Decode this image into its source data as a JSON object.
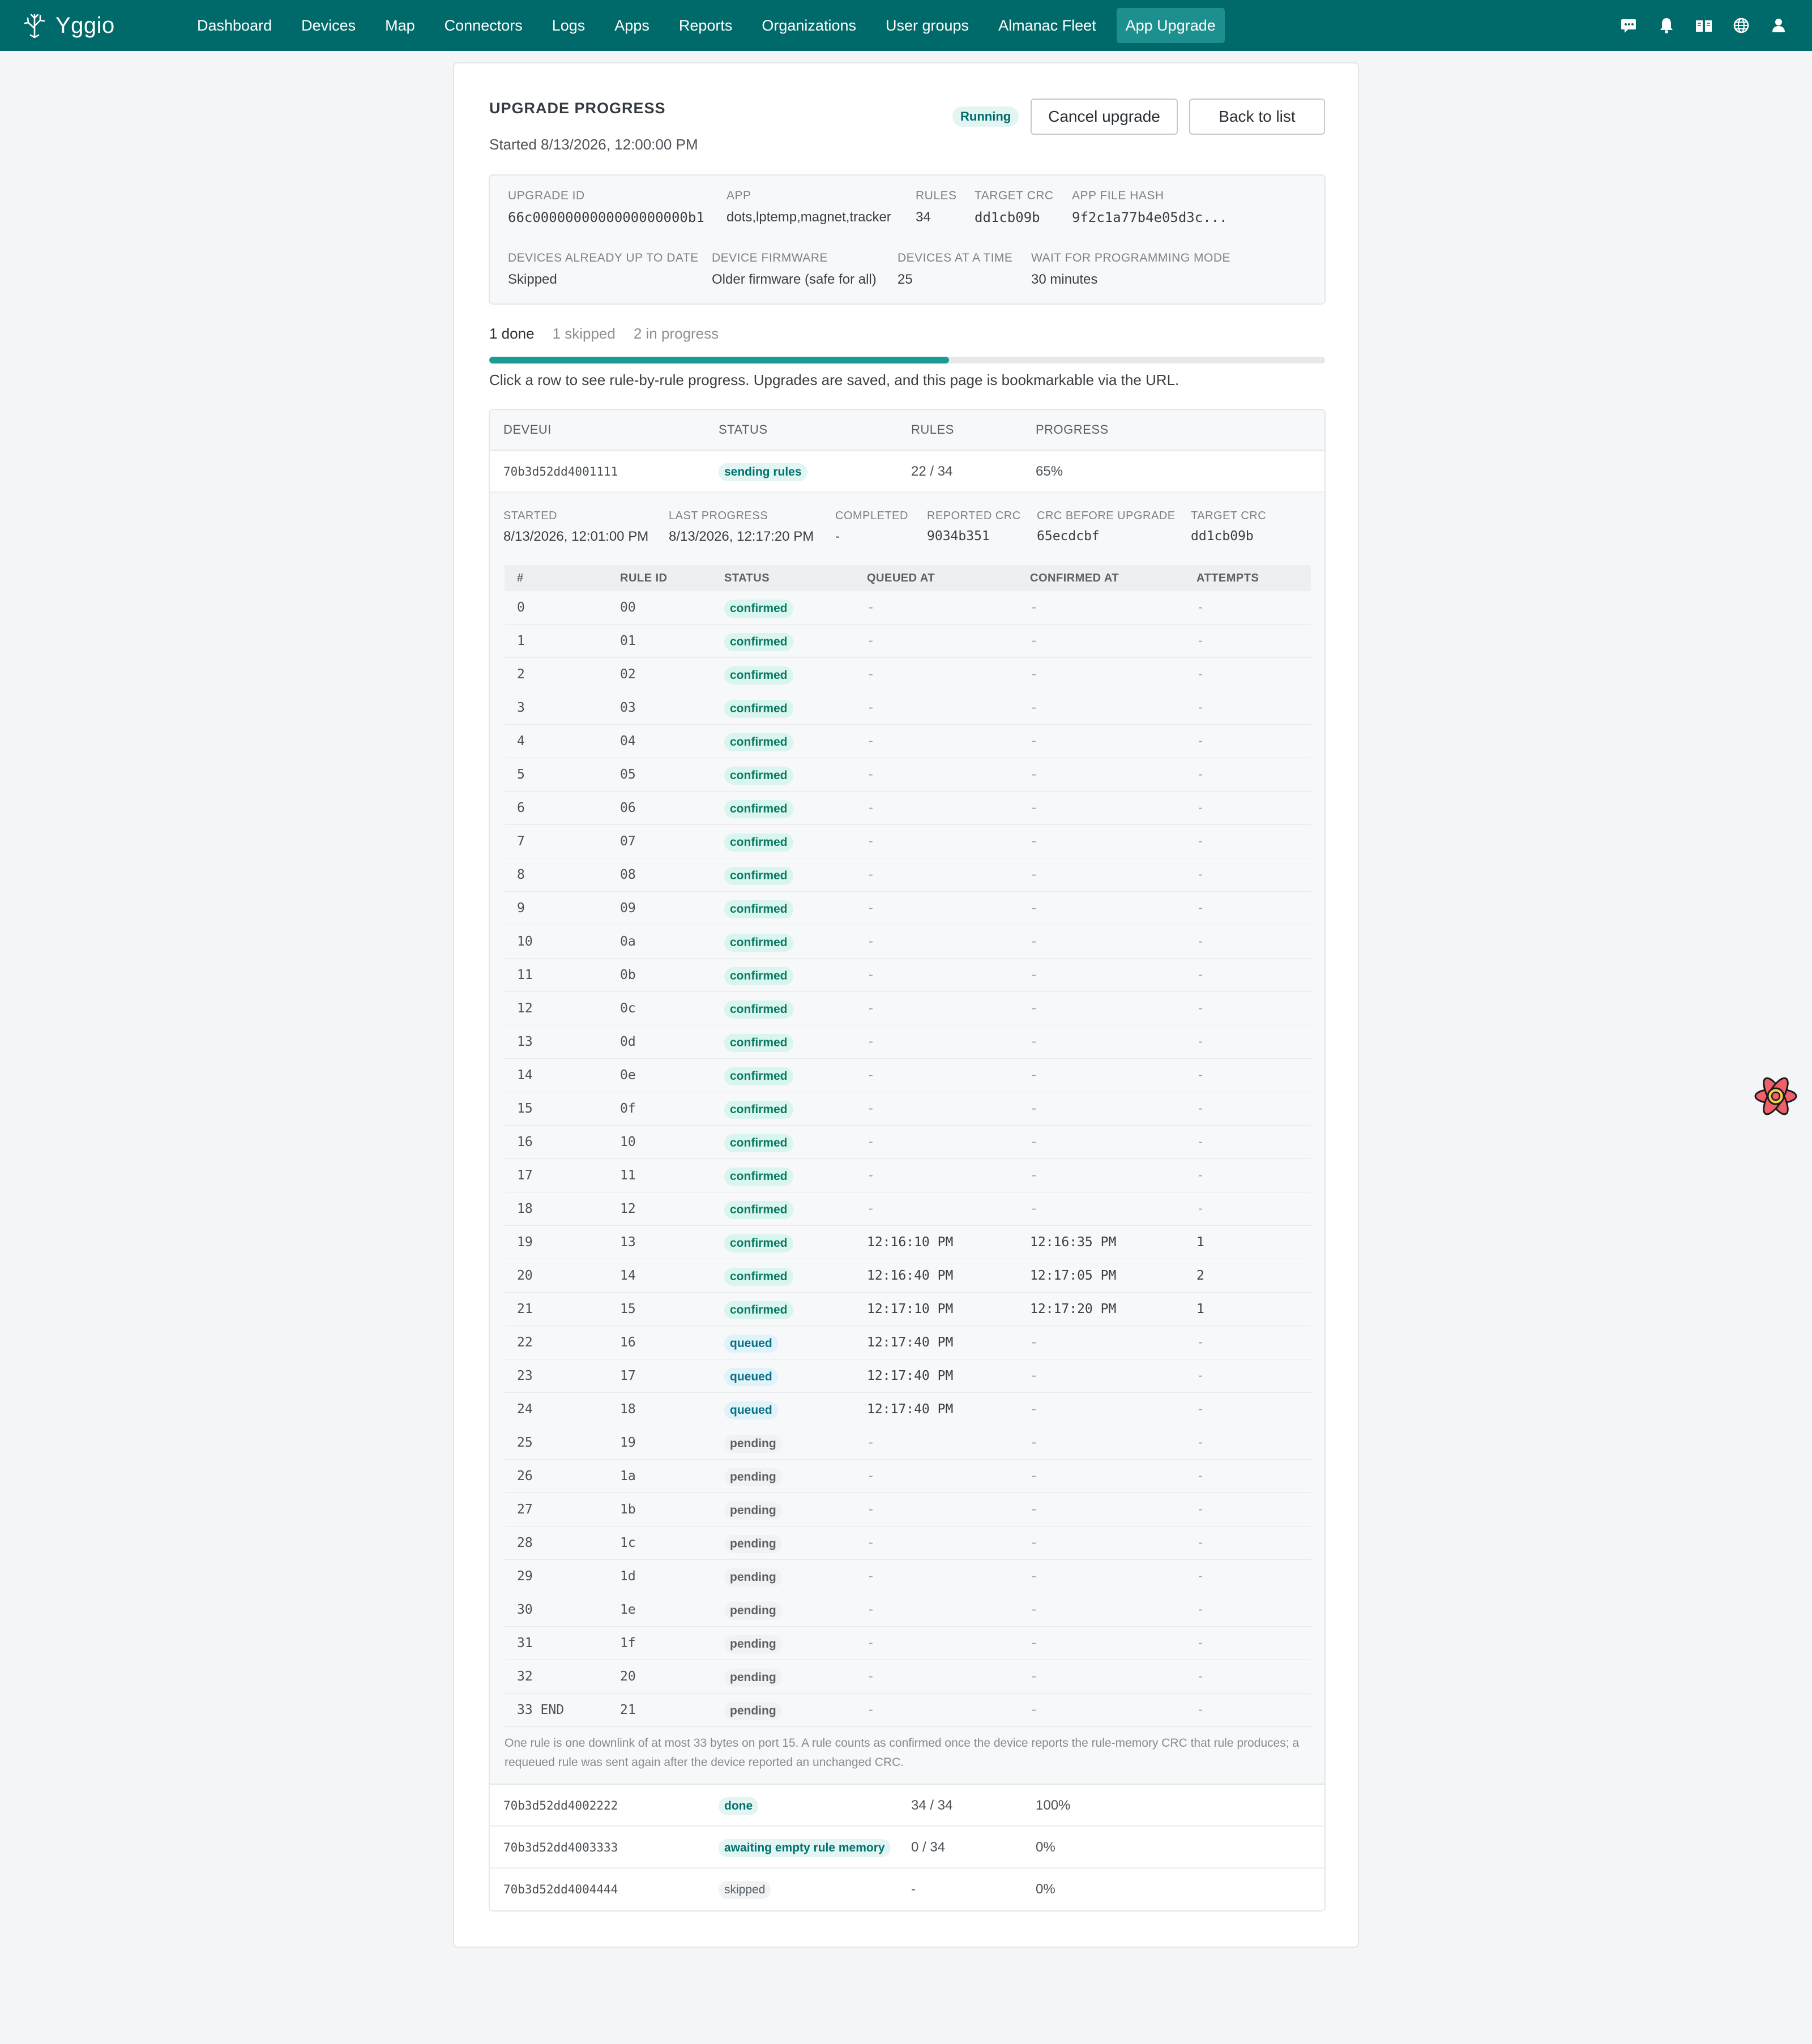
{
  "brand": {
    "name": "Yggio"
  },
  "nav": {
    "items": [
      "Dashboard",
      "Devices",
      "Map",
      "Connectors",
      "Logs",
      "Apps",
      "Reports",
      "Organizations",
      "User groups",
      "Almanac Fleet",
      "App Upgrade"
    ],
    "active_index": 10,
    "icons": [
      "message-icon",
      "bell-icon",
      "book-icon",
      "globe-icon",
      "user-icon"
    ]
  },
  "header": {
    "title": "UPGRADE PROGRESS",
    "started": "Started 8/13/2026, 12:00:00 PM",
    "status_badge": "Running",
    "cancel_label": "Cancel upgrade",
    "back_label": "Back to list"
  },
  "info": {
    "upgrade_id": {
      "label": "UPGRADE ID",
      "value": "66c0000000000000000000b1"
    },
    "app": {
      "label": "APP",
      "value": "dots,lptemp,magnet,tracker"
    },
    "rules": {
      "label": "RULES",
      "value": "34"
    },
    "target_crc": {
      "label": "TARGET CRC",
      "value": "dd1cb09b"
    },
    "app_file_hash": {
      "label": "APP FILE HASH",
      "value": "9f2c1a77b4e05d3c..."
    },
    "devices_up_to_date": {
      "label": "DEVICES ALREADY UP TO DATE",
      "value": "Skipped"
    },
    "device_firmware": {
      "label": "DEVICE FIRMWARE",
      "value": "Older firmware (safe for all)"
    },
    "devices_at_a_time": {
      "label": "DEVICES AT A TIME",
      "value": "25"
    },
    "wait_for_programming": {
      "label": "WAIT FOR PROGRAMMING MODE",
      "value": "30 minutes"
    }
  },
  "tabs": [
    "1 done",
    "1 skipped",
    "2 in progress"
  ],
  "overall_progress_fraction": 0.55,
  "hint": "Click a row to see rule-by-rule progress. Upgrades are saved, and this page is bookmarkable via the URL.",
  "devices": {
    "columns": [
      "DEVEUI",
      "STATUS",
      "RULES",
      "PROGRESS"
    ],
    "rows": [
      {
        "deveui": "70b3d52dd4001111",
        "status": "sending rules",
        "status_kind": "sending",
        "rules": "22 / 34",
        "progress": "65%"
      },
      {
        "deveui": "70b3d52dd4002222",
        "status": "done",
        "status_kind": "done",
        "rules": "34 / 34",
        "progress": "100%"
      },
      {
        "deveui": "70b3d52dd4003333",
        "status": "awaiting empty rule memory",
        "status_kind": "await",
        "rules": "0 / 34",
        "progress": "0%"
      },
      {
        "deveui": "70b3d52dd4004444",
        "status": "skipped",
        "status_kind": "skipped",
        "rules": "-",
        "progress": "0%"
      }
    ]
  },
  "detail": {
    "meta": [
      {
        "label": "STARTED",
        "value": "8/13/2026, 12:01:00 PM",
        "mono": false
      },
      {
        "label": "LAST PROGRESS",
        "value": "8/13/2026, 12:17:20 PM",
        "mono": false
      },
      {
        "label": "COMPLETED",
        "value": "-",
        "mono": false
      },
      {
        "label": "REPORTED CRC",
        "value": "9034b351",
        "mono": true
      },
      {
        "label": "CRC BEFORE UPGRADE",
        "value": "65ecdcbf",
        "mono": true
      },
      {
        "label": "TARGET CRC",
        "value": "dd1cb09b",
        "mono": true
      }
    ],
    "rule_columns": [
      "#",
      "RULE ID",
      "STATUS",
      "QUEUED AT",
      "CONFIRMED AT",
      "ATTEMPTS"
    ],
    "rules": [
      [
        "0",
        "00",
        "confirmed",
        "-",
        "-",
        "-"
      ],
      [
        "1",
        "01",
        "confirmed",
        "-",
        "-",
        "-"
      ],
      [
        "2",
        "02",
        "confirmed",
        "-",
        "-",
        "-"
      ],
      [
        "3",
        "03",
        "confirmed",
        "-",
        "-",
        "-"
      ],
      [
        "4",
        "04",
        "confirmed",
        "-",
        "-",
        "-"
      ],
      [
        "5",
        "05",
        "confirmed",
        "-",
        "-",
        "-"
      ],
      [
        "6",
        "06",
        "confirmed",
        "-",
        "-",
        "-"
      ],
      [
        "7",
        "07",
        "confirmed",
        "-",
        "-",
        "-"
      ],
      [
        "8",
        "08",
        "confirmed",
        "-",
        "-",
        "-"
      ],
      [
        "9",
        "09",
        "confirmed",
        "-",
        "-",
        "-"
      ],
      [
        "10",
        "0a",
        "confirmed",
        "-",
        "-",
        "-"
      ],
      [
        "11",
        "0b",
        "confirmed",
        "-",
        "-",
        "-"
      ],
      [
        "12",
        "0c",
        "confirmed",
        "-",
        "-",
        "-"
      ],
      [
        "13",
        "0d",
        "confirmed",
        "-",
        "-",
        "-"
      ],
      [
        "14",
        "0e",
        "confirmed",
        "-",
        "-",
        "-"
      ],
      [
        "15",
        "0f",
        "confirmed",
        "-",
        "-",
        "-"
      ],
      [
        "16",
        "10",
        "confirmed",
        "-",
        "-",
        "-"
      ],
      [
        "17",
        "11",
        "confirmed",
        "-",
        "-",
        "-"
      ],
      [
        "18",
        "12",
        "confirmed",
        "-",
        "-",
        "-"
      ],
      [
        "19",
        "13",
        "confirmed",
        "12:16:10 PM",
        "12:16:35 PM",
        "1"
      ],
      [
        "20",
        "14",
        "confirmed",
        "12:16:40 PM",
        "12:17:05 PM",
        "2"
      ],
      [
        "21",
        "15",
        "confirmed",
        "12:17:10 PM",
        "12:17:20 PM",
        "1"
      ],
      [
        "22",
        "16",
        "queued",
        "12:17:40 PM",
        "-",
        "-"
      ],
      [
        "23",
        "17",
        "queued",
        "12:17:40 PM",
        "-",
        "-"
      ],
      [
        "24",
        "18",
        "queued",
        "12:17:40 PM",
        "-",
        "-"
      ],
      [
        "25",
        "19",
        "pending",
        "-",
        "-",
        "-"
      ],
      [
        "26",
        "1a",
        "pending",
        "-",
        "-",
        "-"
      ],
      [
        "27",
        "1b",
        "pending",
        "-",
        "-",
        "-"
      ],
      [
        "28",
        "1c",
        "pending",
        "-",
        "-",
        "-"
      ],
      [
        "29",
        "1d",
        "pending",
        "-",
        "-",
        "-"
      ],
      [
        "30",
        "1e",
        "pending",
        "-",
        "-",
        "-"
      ],
      [
        "31",
        "1f",
        "pending",
        "-",
        "-",
        "-"
      ],
      [
        "32",
        "20",
        "pending",
        "-",
        "-",
        "-"
      ],
      [
        "33 END",
        "21",
        "pending",
        "-",
        "-",
        "-"
      ]
    ],
    "footnote": "One rule is one downlink of at most 33 bytes on port 15. A rule counts as confirmed once the device reports the rule-memory CRC that rule produces; a requeued rule was sent again after the device reported an unchanged CRC."
  },
  "colors": {
    "brand": "#006a6a",
    "nav_active": "#1e8f8f",
    "progress": "#1b9a96"
  }
}
